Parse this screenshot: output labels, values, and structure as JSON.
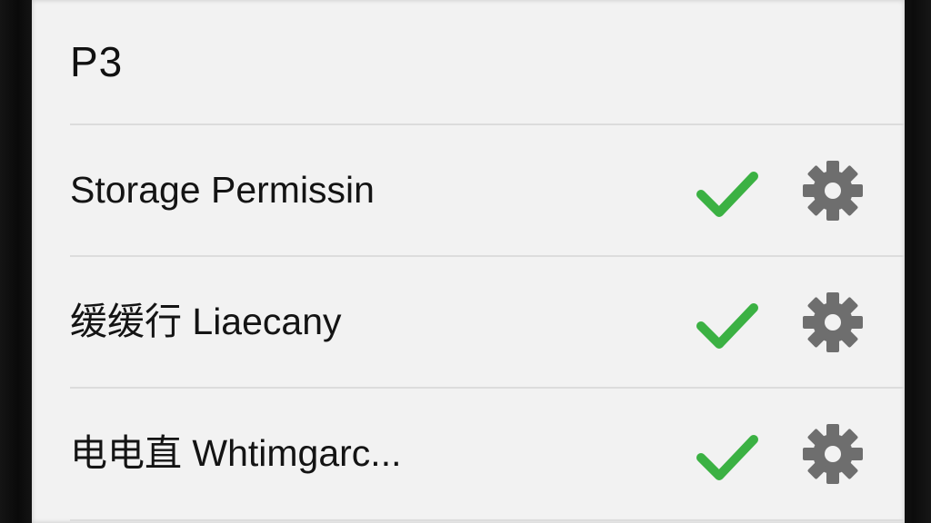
{
  "header": {
    "title": "P3"
  },
  "colors": {
    "check": "#3bb143",
    "gear": "#6e6e6e",
    "background": "#f2f2f2",
    "divider": "#dcdcdc"
  },
  "rows": [
    {
      "label": "Storage Permissin",
      "status_icon": "checkmark-icon",
      "action_icon": "gear-icon"
    },
    {
      "label": "缓缓行 Liaecany",
      "status_icon": "checkmark-icon",
      "action_icon": "gear-icon"
    },
    {
      "label": "电电直 Whtimgarc...",
      "status_icon": "checkmark-icon",
      "action_icon": "gear-icon"
    }
  ]
}
